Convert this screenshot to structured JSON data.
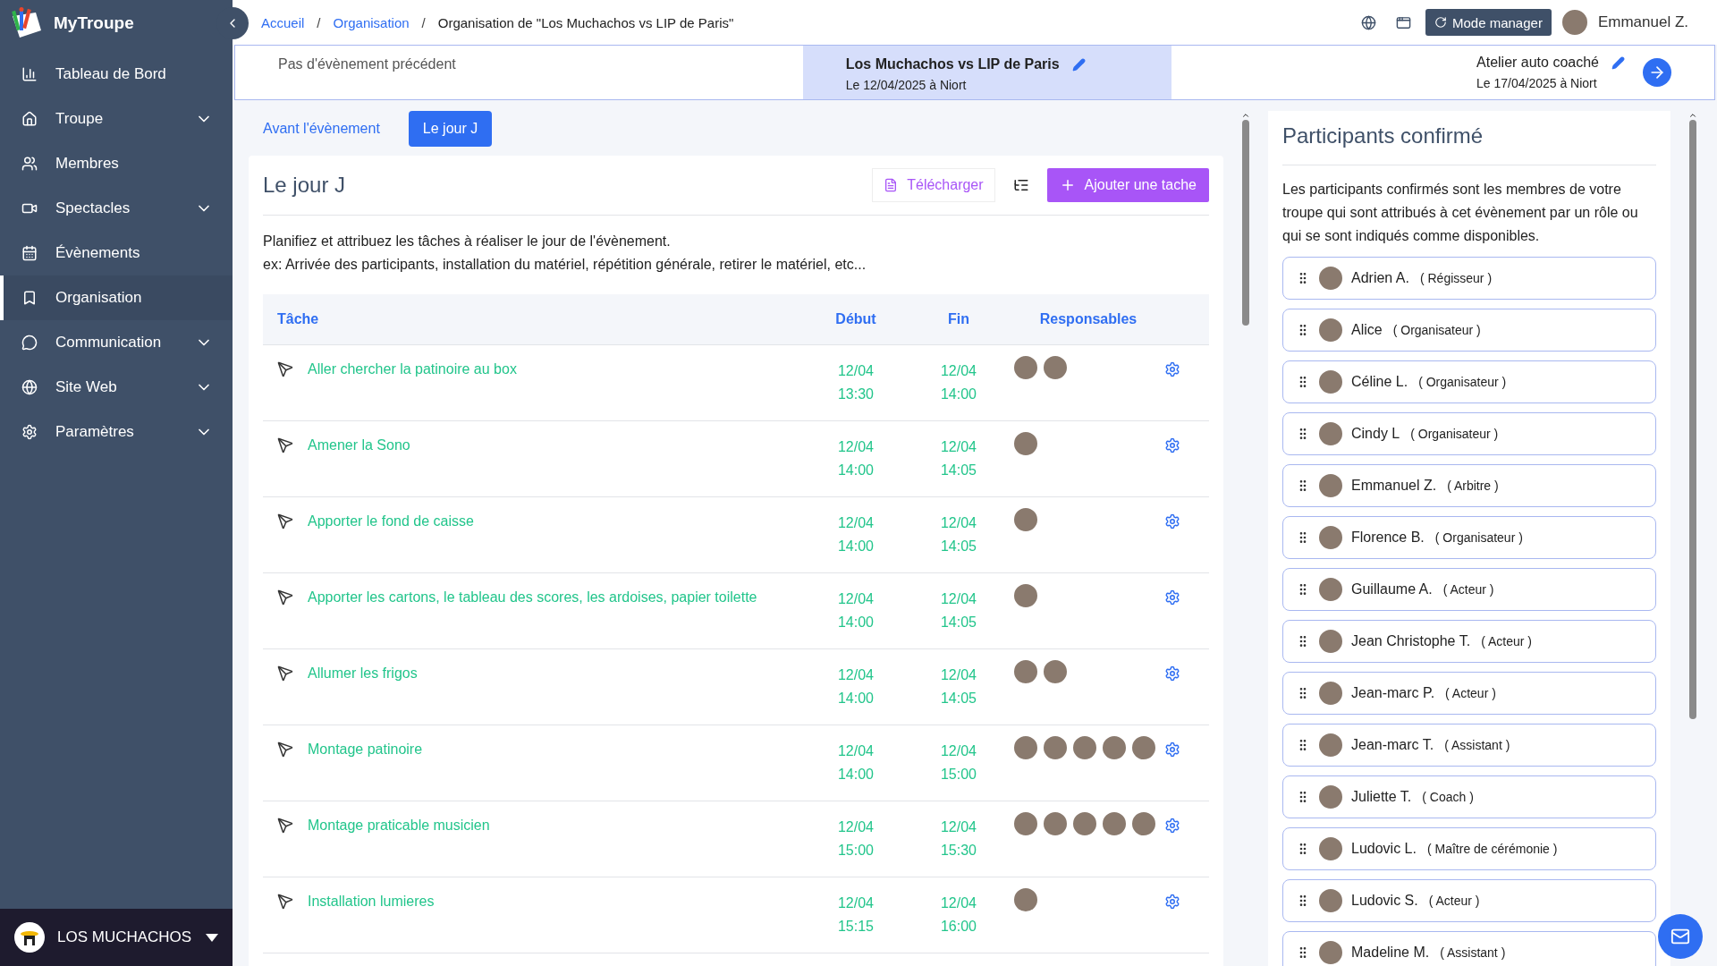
{
  "app": {
    "name": "MyTroupe"
  },
  "sidebar": {
    "items": [
      {
        "label": "Tableau de Bord",
        "kind": "link",
        "selected": false
      },
      {
        "label": "Troupe",
        "kind": "group",
        "selected": false
      },
      {
        "label": "Membres",
        "kind": "link",
        "selected": false
      },
      {
        "label": "Spectacles",
        "kind": "group",
        "selected": false
      },
      {
        "label": "Évènements",
        "kind": "link",
        "selected": false
      },
      {
        "label": "Organisation",
        "kind": "link",
        "selected": true
      },
      {
        "label": "Communication",
        "kind": "group",
        "selected": false
      },
      {
        "label": "Site Web",
        "kind": "group",
        "selected": false
      },
      {
        "label": "Paramètres",
        "kind": "group",
        "selected": false
      }
    ],
    "troupe": {
      "name": "LOS MUCHACHOS"
    }
  },
  "breadcrumb": [
    {
      "label": "Accueil",
      "kind": "link"
    },
    {
      "separator": "/",
      "label": "Organisation",
      "kind": "link"
    },
    {
      "separator": "/",
      "label": "Organisation de \"Los Muchachos vs LIP de Paris\"",
      "kind": "current"
    }
  ],
  "header": {
    "mode_button": "Mode manager",
    "user": "Emmanuel Z."
  },
  "events": {
    "previous": "Pas d'évènement précédent",
    "current": {
      "title": "Los Muchachos vs LIP de Paris",
      "subtitle": "Le 12/04/2025 à Niort"
    },
    "next": {
      "title": "Atelier auto coaché",
      "subtitle": "Le 17/04/2025 à Niort"
    }
  },
  "tabs": [
    {
      "label": "Avant l'évènement",
      "selected": false
    },
    {
      "label": "Le jour J",
      "selected": true
    }
  ],
  "card": {
    "title": "Le jour J",
    "download": "Télécharger",
    "add": "Ajouter une tache",
    "description": [
      "Planifiez et attribuez les tâches à réaliser le jour de l'évènement.",
      "ex: Arrivée des participants, installation du matériel, répétition générale, retirer le matériel, etc..."
    ],
    "table": {
      "columns": [
        "Tâche",
        "Début",
        "Fin",
        "Responsables"
      ],
      "rows": [
        {
          "task": "Aller chercher la patinoire au box",
          "start": [
            "12/04",
            "13:30"
          ],
          "end": [
            "12/04",
            "14:00"
          ],
          "responsables": [
            {
              "kind": "photo"
            },
            {
              "kind": "photo"
            }
          ]
        },
        {
          "task": "Amener la Sono",
          "start": [
            "12/04",
            "14:00"
          ],
          "end": [
            "12/04",
            "14:05"
          ],
          "responsables": [
            {
              "kind": "photo"
            }
          ]
        },
        {
          "task": "Apporter le fond de caisse",
          "start": [
            "12/04",
            "14:00"
          ],
          "end": [
            "12/04",
            "14:05"
          ],
          "responsables": [
            {
              "kind": "photo"
            }
          ]
        },
        {
          "task": "Apporter les cartons, le tableau des scores, les ardoises, papier toilette",
          "start": [
            "12/04",
            "14:00"
          ],
          "end": [
            "12/04",
            "14:05"
          ],
          "responsables": [
            {
              "kind": "photo"
            }
          ]
        },
        {
          "task": "Allumer les frigos",
          "start": [
            "12/04",
            "14:00"
          ],
          "end": [
            "12/04",
            "14:05"
          ],
          "responsables": [
            {
              "kind": "photo"
            },
            {
              "kind": "photo"
            }
          ]
        },
        {
          "task": "Montage patinoire",
          "start": [
            "12/04",
            "14:00"
          ],
          "end": [
            "12/04",
            "15:00"
          ],
          "responsables": [
            {
              "kind": "photo"
            },
            {
              "kind": "photo"
            },
            {
              "kind": "photo"
            },
            {
              "kind": "photo"
            },
            {
              "kind": "photo"
            }
          ]
        },
        {
          "task": "Montage praticable musicien",
          "start": [
            "12/04",
            "15:00"
          ],
          "end": [
            "12/04",
            "15:30"
          ],
          "responsables": [
            {
              "kind": "photo"
            },
            {
              "kind": "photo"
            },
            {
              "kind": "photo"
            },
            {
              "kind": "photo"
            },
            {
              "kind": "photo"
            }
          ]
        },
        {
          "task": "Installation lumieres",
          "start": [
            "12/04",
            "15:15"
          ],
          "end": [
            "12/04",
            "16:00"
          ],
          "responsables": [
            {
              "kind": "photo"
            }
          ]
        }
      ]
    }
  },
  "participants": {
    "title": "Participants confirmé",
    "description": "Les participants confirmés sont les membres de votre troupe qui sont attribués à cet évènement par un rôle ou qui se sont indiqués comme disponibles.",
    "items": [
      {
        "name": "Adrien A.",
        "role": "( Régisseur )"
      },
      {
        "name": "Alice",
        "role": "( Organisateur )"
      },
      {
        "name": "Céline L.",
        "role": "( Organisateur )"
      },
      {
        "name": "Cindy L",
        "role": "( Organisateur )"
      },
      {
        "name": "Emmanuel Z.",
        "role": "( Arbitre )"
      },
      {
        "name": "Florence B.",
        "role": "( Organisateur )"
      },
      {
        "name": "Guillaume A.",
        "role": "( Acteur )"
      },
      {
        "name": "Jean Christophe T.",
        "role": "( Acteur )"
      },
      {
        "name": "Jean-marc P.",
        "role": "( Acteur )"
      },
      {
        "name": "Jean-marc T.",
        "role": "( Assistant )"
      },
      {
        "name": "Juliette T.",
        "role": "( Coach )"
      },
      {
        "name": "Ludovic L.",
        "role": "( Maître de cérémonie )"
      },
      {
        "name": "Ludovic S.",
        "role": "( Acteur )"
      },
      {
        "name": "Madeline M.",
        "role": "( Assistant )"
      }
    ]
  }
}
